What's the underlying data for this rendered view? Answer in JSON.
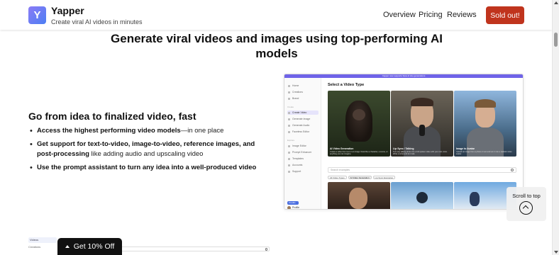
{
  "header": {
    "logo_letter": "Y",
    "brand_name": "Yapper",
    "tagline": "Create viral AI videos in minutes",
    "nav": [
      "Overview",
      "Pricing",
      "Reviews"
    ],
    "cta": "Sold out!"
  },
  "main": {
    "headline": "Generate viral videos and images using top-performing AI models",
    "section_title": "Go from idea to finalized video, fast",
    "bullets": [
      {
        "bold": "Access the highest performing video models",
        "rest": "—in one place"
      },
      {
        "bold": "Get support for text-to-video, image-to-video, reference images, and post-processing",
        "rest": " like adding audio and upscaling video"
      },
      {
        "bold": "Use the prompt assistant to turn any idea into a well-produced video",
        "rest": ""
      }
    ]
  },
  "mock": {
    "top_bar": "Yapper now supports Sora & Veo generations",
    "sidebar_heads": [
      "Create",
      "Explore"
    ],
    "sidebar_items": [
      "Home",
      "Creations",
      "Brand",
      "Create Video",
      "Generate Image",
      "Generate Audio",
      "Faceless Editor",
      "Image Editor",
      "Prompt Enhancer",
      "Templates",
      "Accounts",
      "Support"
    ],
    "credits": "Credits",
    "profile": "Profile",
    "title": "Select a Video Type",
    "cards": [
      {
        "label": "AI Video Generation",
        "desc": "Create a video from text or an image. Describe a character, a scene, or anything you can imagine."
      },
      {
        "label": "Lip Sync / Talking",
        "desc": "Turn any talking photo into a full spoken video with your own voice. Write a script and let it talk."
      },
      {
        "label": "Image to Avatar",
        "desc": "Upload an image from a photo or text and turn it into a realistic video avatar."
      }
    ],
    "search_placeholder": "Search examples",
    "filters": [
      "All Video Types",
      "AI Video Generation",
      "Lip Sync Examples"
    ]
  },
  "scroll_to_top": "Scroll to top",
  "bottom": {
    "tab": "Videos",
    "row": "Creations"
  },
  "discount": "Get 10% Off"
}
